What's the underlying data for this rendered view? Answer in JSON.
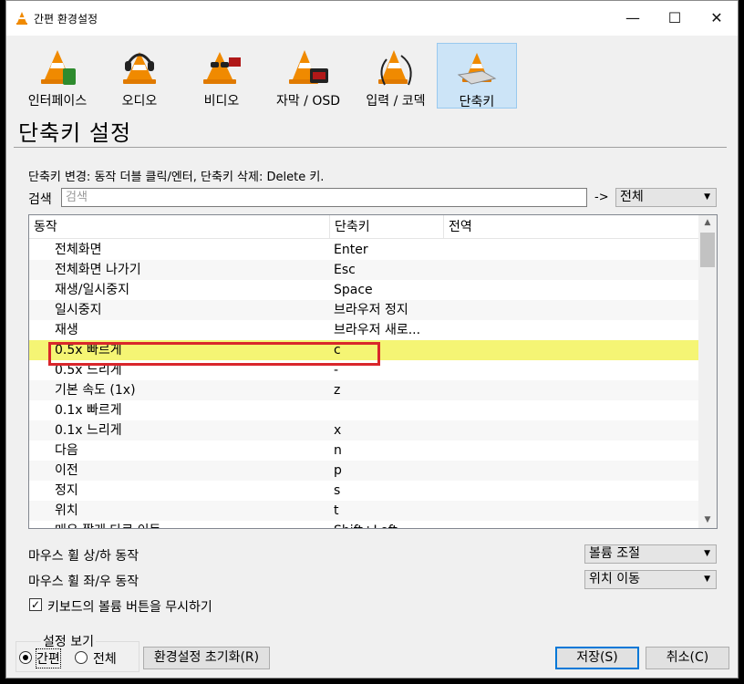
{
  "window": {
    "title": "간편 환경설정"
  },
  "categories": [
    {
      "id": "interface",
      "label": "인터페이스",
      "icon": "vlc-cone-interface-icon"
    },
    {
      "id": "audio",
      "label": "오디오",
      "icon": "vlc-cone-headphones-icon"
    },
    {
      "id": "video",
      "label": "비디오",
      "icon": "vlc-cone-glasses-icon"
    },
    {
      "id": "subtitles",
      "label": "자막 / OSD",
      "icon": "vlc-cone-clock-icon"
    },
    {
      "id": "input",
      "label": "입력 / 코덱",
      "icon": "vlc-cone-cable-icon"
    },
    {
      "id": "hotkeys",
      "label": "단축키",
      "icon": "vlc-cone-keyboard-icon",
      "selected": true
    }
  ],
  "section": {
    "title": "단축키 설정",
    "hint": "단축키 변경: 동작 더블 클릭/엔터, 단축키 삭제: Delete 키."
  },
  "search": {
    "label": "검색",
    "placeholder": "검색",
    "value": "",
    "arrow": "->",
    "filter_value": "전체"
  },
  "table": {
    "columns": {
      "action": "동작",
      "hotkey": "단축키",
      "global": "전역"
    },
    "rows": [
      {
        "action": "전체화면",
        "hotkey": "Enter"
      },
      {
        "action": "전체화면 나가기",
        "hotkey": "Esc"
      },
      {
        "action": "재생/일시중지",
        "hotkey": "Space"
      },
      {
        "action": "일시중지",
        "hotkey": "브라우저 정지"
      },
      {
        "action": "재생",
        "hotkey": "브라우저 새로..."
      },
      {
        "action": "0.5x 빠르게",
        "hotkey": "c",
        "highlighted": true
      },
      {
        "action": "0.5x 느리게",
        "hotkey": "-"
      },
      {
        "action": "기본 속도 (1x)",
        "hotkey": "z"
      },
      {
        "action": "0.1x 빠르게",
        "hotkey": ""
      },
      {
        "action": "0.1x 느리게",
        "hotkey": "x"
      },
      {
        "action": "다음",
        "hotkey": "n"
      },
      {
        "action": "이전",
        "hotkey": "p"
      },
      {
        "action": "정지",
        "hotkey": "s"
      },
      {
        "action": "위치",
        "hotkey": "t"
      },
      {
        "action": "매우 짧게 다로 이동",
        "hotkey": "Shift+Left"
      }
    ]
  },
  "mouse": {
    "wheel_vertical_label": "마우스 휠 상/하 동작",
    "wheel_vertical_value": "볼륨 조절",
    "wheel_horizontal_label": "마우스 휠 좌/우 동작",
    "wheel_horizontal_value": "위치 이동"
  },
  "keyboard": {
    "ignore_volume_label": "키보드의 볼륨 버튼을 무시하기",
    "ignore_volume_checked": true,
    "check_glyph": "✓"
  },
  "view": {
    "group_title": "설정 보기",
    "simple_label": "간편",
    "all_label": "전체",
    "selected": "simple"
  },
  "buttons": {
    "reset": "환경설정 초기화(R)",
    "save": "저장(S)",
    "cancel": "취소(C)"
  },
  "window_controls": {
    "minimize": "—",
    "maximize": "☐",
    "close": "✕"
  },
  "colors": {
    "selected_category_bg": "#cce4f7",
    "highlight_row": "#f5f574",
    "highlight_border": "#d9262b",
    "default_button_border": "#0078d7"
  }
}
